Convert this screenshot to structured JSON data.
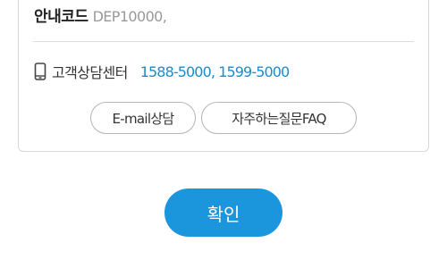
{
  "info_card": {
    "code_label": "안내코드",
    "code_value": "DEP10000,",
    "center_label": "고객상담센터",
    "center_numbers": "1588-5000, 1599-5000",
    "phone_icon": "mobile-phone-icon",
    "email_button_label": "E-mail상담",
    "faq_button_label": "자주하는질문FAQ"
  },
  "confirm_button_label": "확인",
  "colors": {
    "accent": "#1b96dc",
    "link": "#1a8ccc",
    "muted_text": "#999999",
    "border": "#d8d8d8"
  }
}
